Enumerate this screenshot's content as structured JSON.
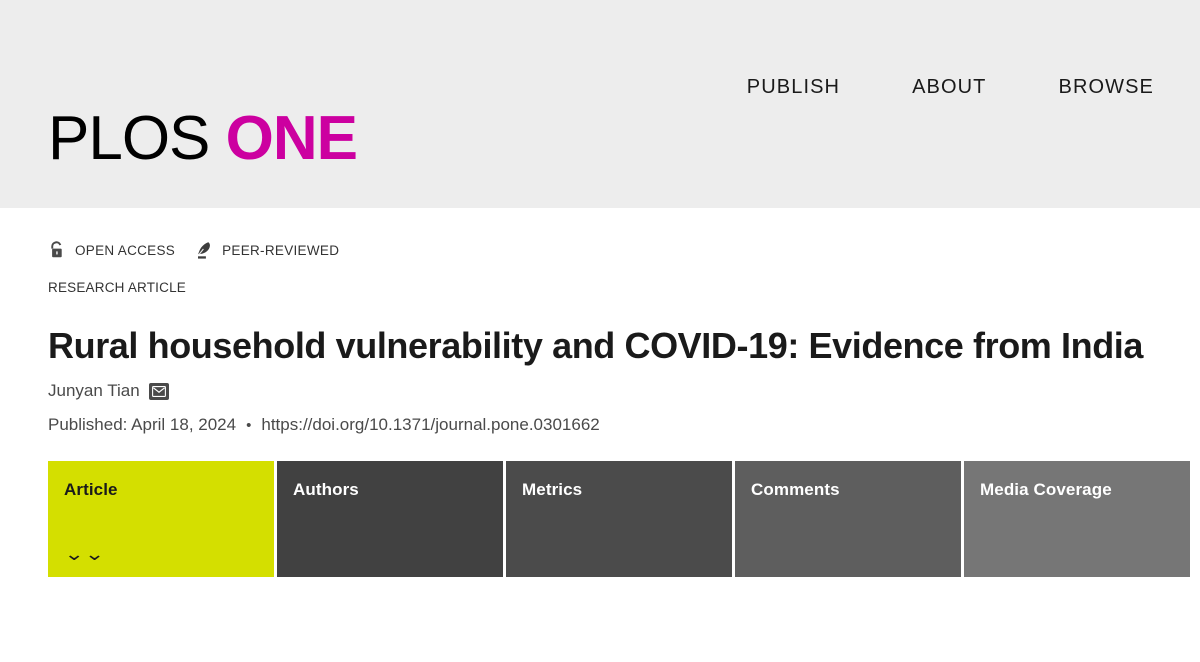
{
  "header": {
    "logo": {
      "primary": "PLOS",
      "secondary": "ONE",
      "secondary_color": "#cc00a0",
      "background": "#ededed"
    },
    "nav": [
      {
        "label": "PUBLISH"
      },
      {
        "label": "ABOUT"
      },
      {
        "label": "BROWSE"
      }
    ]
  },
  "article": {
    "badges": [
      {
        "icon": "open-lock-icon",
        "label": "OPEN ACCESS"
      },
      {
        "icon": "quill-pen-icon",
        "label": "PEER-REVIEWED"
      }
    ],
    "type_label": "RESEARCH ARTICLE",
    "title": "Rural household vulnerability and COVID-19: Evidence from India",
    "author": {
      "name": "Junyan Tian",
      "contact_icon": "envelope-icon"
    },
    "publication": {
      "published_label": "Published: April 18, 2024",
      "separator": "•",
      "doi": "https://doi.org/10.1371/journal.pone.0301662"
    }
  },
  "tabs": {
    "active_color": "#d4df00",
    "items": [
      {
        "label": "Article",
        "active": true,
        "expand_icon": "chevron-double-down-icon",
        "color": "#d4df00"
      },
      {
        "label": "Authors",
        "active": false,
        "color": "#414141"
      },
      {
        "label": "Metrics",
        "active": false,
        "color": "#4b4b4b"
      },
      {
        "label": "Comments",
        "active": false,
        "color": "#5e5e5e"
      },
      {
        "label": "Media Coverage",
        "active": false,
        "color": "#767676"
      }
    ]
  }
}
